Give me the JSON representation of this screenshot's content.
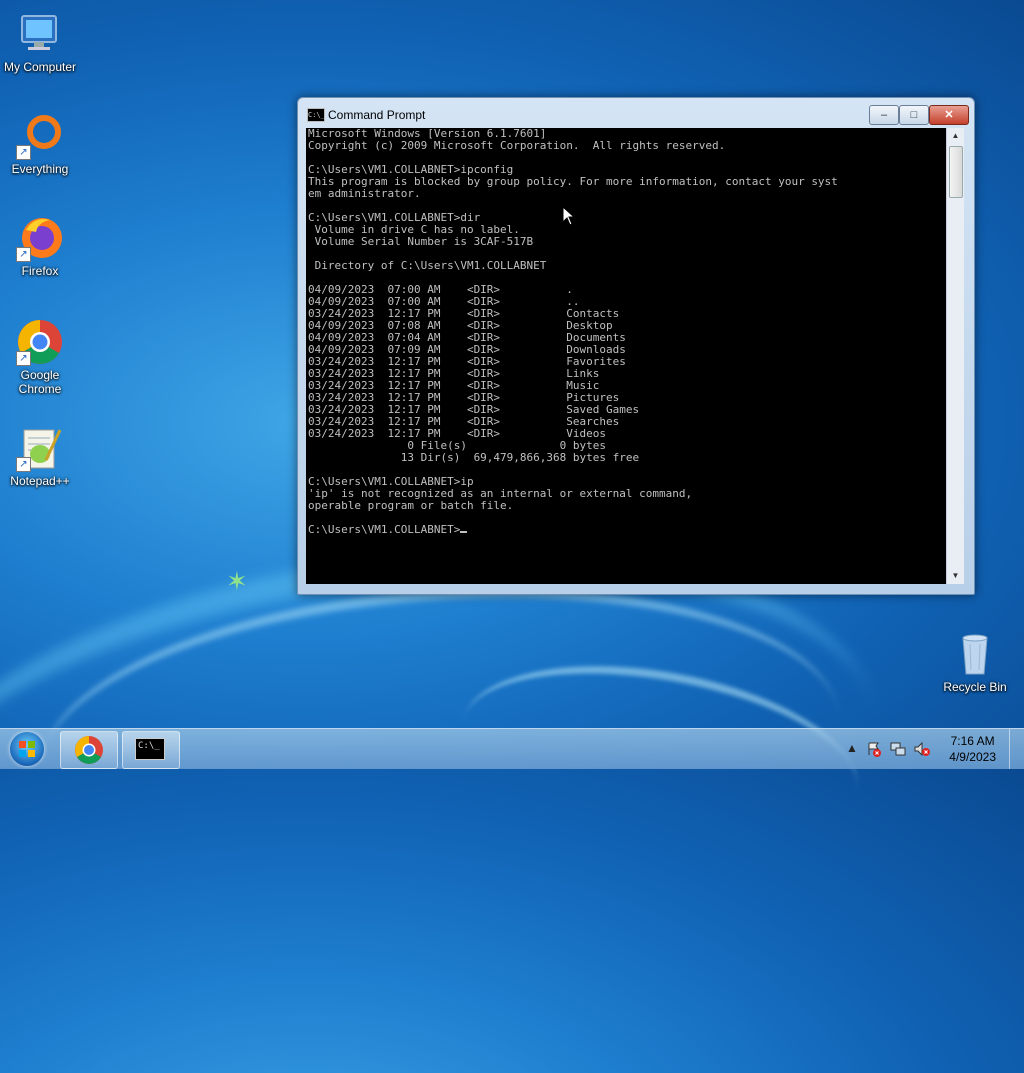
{
  "desktop": {
    "icons": [
      {
        "label": "My Computer"
      },
      {
        "label": "Everything"
      },
      {
        "label": "Firefox"
      },
      {
        "label": "Google Chrome"
      },
      {
        "label": "Notepad++"
      },
      {
        "label": "Recycle Bin"
      }
    ]
  },
  "window": {
    "title": "Command Prompt",
    "min_glyph": "–",
    "max_glyph": "□",
    "close_glyph": "✕",
    "title_icon_text": "C:\\_",
    "console_lines": [
      "Microsoft Windows [Version 6.1.7601]",
      "Copyright (c) 2009 Microsoft Corporation.  All rights reserved.",
      "",
      "C:\\Users\\VM1.COLLABNET>ipconfig",
      "This program is blocked by group policy. For more information, contact your syst",
      "em administrator.",
      "",
      "C:\\Users\\VM1.COLLABNET>dir",
      " Volume in drive C has no label.",
      " Volume Serial Number is 3CAF-517B",
      "",
      " Directory of C:\\Users\\VM1.COLLABNET",
      "",
      "04/09/2023  07:00 AM    <DIR>          .",
      "04/09/2023  07:00 AM    <DIR>          ..",
      "03/24/2023  12:17 PM    <DIR>          Contacts",
      "04/09/2023  07:08 AM    <DIR>          Desktop",
      "04/09/2023  07:04 AM    <DIR>          Documents",
      "04/09/2023  07:09 AM    <DIR>          Downloads",
      "03/24/2023  12:17 PM    <DIR>          Favorites",
      "03/24/2023  12:17 PM    <DIR>          Links",
      "03/24/2023  12:17 PM    <DIR>          Music",
      "03/24/2023  12:17 PM    <DIR>          Pictures",
      "03/24/2023  12:17 PM    <DIR>          Saved Games",
      "03/24/2023  12:17 PM    <DIR>          Searches",
      "03/24/2023  12:17 PM    <DIR>          Videos",
      "               0 File(s)              0 bytes",
      "              13 Dir(s)  69,479,866,368 bytes free",
      "",
      "C:\\Users\\VM1.COLLABNET>ip",
      "'ip' is not recognized as an internal or external command,",
      "operable program or batch file.",
      ""
    ],
    "prompt": "C:\\Users\\VM1.COLLABNET>"
  },
  "taskbar": {
    "items": [
      {
        "icon": "chrome-icon"
      },
      {
        "icon": "command-prompt-icon",
        "glyph": "C:\\_"
      }
    ],
    "tray": {
      "time": "7:16 AM",
      "date": "4/9/2023",
      "show_hidden_glyph": "▲"
    }
  },
  "colors": {
    "console_bg": "#000000",
    "console_fg": "#c0c0c0",
    "desktop_blue": "#1f7fd0"
  }
}
